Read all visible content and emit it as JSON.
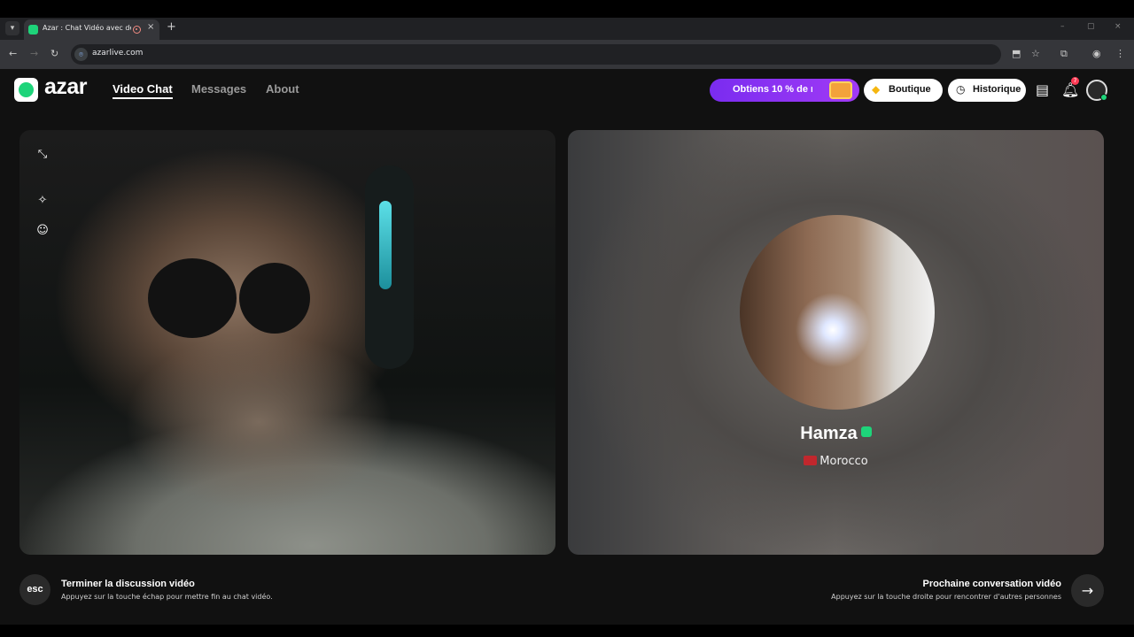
{
  "browser": {
    "tab_menu_icon": "chevron-down-icon",
    "tab_title": "Azar : Chat Vidéo avec de n",
    "tab_favicon_color": "#1ed47a",
    "tab_close": "×",
    "new_tab": "+",
    "url": "azarlive.com",
    "window_controls": {
      "minimize": "–",
      "maximize": "▢",
      "close": "×"
    },
    "nav": {
      "back": "←",
      "forward": "→",
      "reload": "↻"
    },
    "toolbar_icons": {
      "install": "⬒",
      "bookmark": "☆",
      "extensions": "⧉",
      "profile": "◉",
      "menu": "⋮"
    }
  },
  "app": {
    "logo_text": "azar",
    "brand_color": "#1ed47a",
    "nav": {
      "video_chat": "Video Chat",
      "messages": "Messages",
      "about": "About"
    },
    "promo_text": "Obtiens 10 % de r",
    "promo_color": "#8a33f3",
    "shop_label": "Boutique",
    "history_label": "Historique",
    "notification_count": "7",
    "left_tools": [
      "minimize-icon",
      "magic-wand-icon",
      "face-filter-icon"
    ],
    "partner": {
      "name": "Hamza",
      "country": "Morocco"
    },
    "footer": {
      "esc_key": "esc",
      "end_title": "Terminer la discussion vidéo",
      "end_sub": "Appuyez sur la touche échap pour mettre fin au chat vidéo.",
      "next_title": "Prochaine conversation vidéo",
      "next_sub": "Appuyez sur la touche droite pour rencontrer d'autres personnes",
      "next_icon": "→"
    }
  }
}
